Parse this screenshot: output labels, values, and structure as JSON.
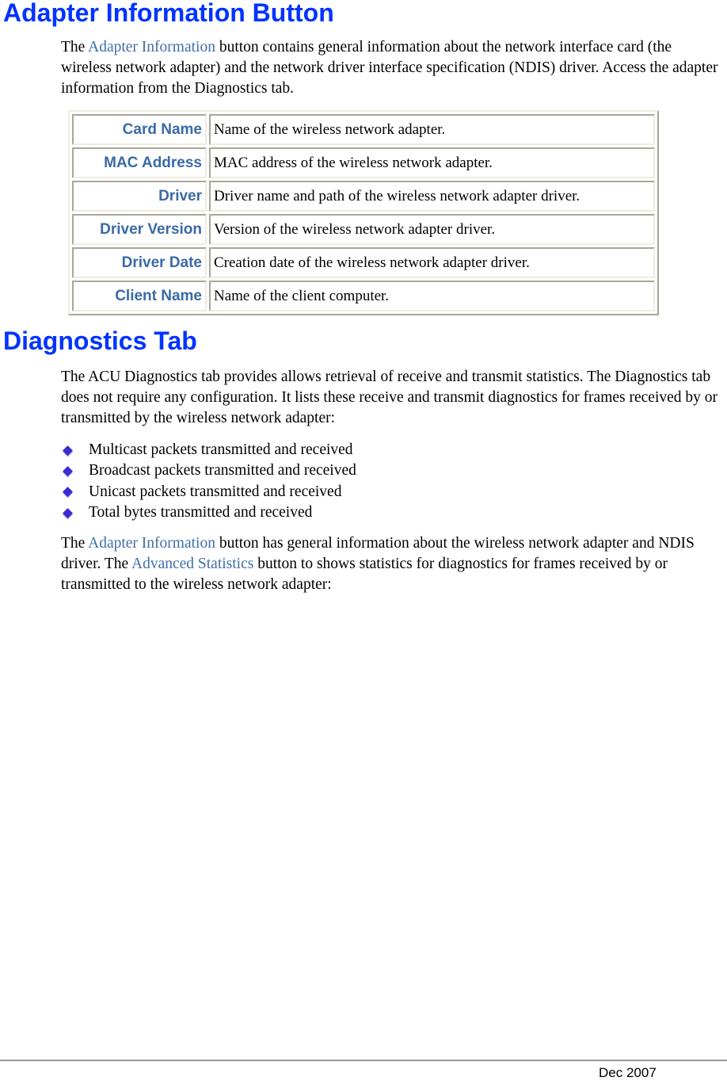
{
  "section1": {
    "heading": "Adapter Information Button",
    "paragraph": {
      "before": "The ",
      "link": "Adapter Information",
      "after": " button contains general information about the network interface card (the wireless network adapter) and the network driver interface specification (NDIS) driver.  Access the adapter information from the Diagnostics tab."
    },
    "table": [
      {
        "label": "Card Name",
        "description": "Name of the wireless network adapter."
      },
      {
        "label": "MAC Address",
        "description": "MAC address of the wireless network adapter."
      },
      {
        "label": "Driver",
        "description": "Driver name and path of the wireless network adapter driver."
      },
      {
        "label": "Driver Version",
        "description": "Version of the wireless network adapter driver."
      },
      {
        "label": "Driver Date",
        "description": "Creation date of the wireless network adapter driver."
      },
      {
        "label": "Client Name",
        "description": "Name of the client computer."
      }
    ]
  },
  "section2": {
    "heading": "Diagnostics Tab",
    "paragraph1": "The ACU Diagnostics tab provides allows retrieval of receive and transmit statistics. The Diagnostics tab does not require any configuration.  It lists these receive and transmit diagnostics for frames received by or transmitted by the wireless network adapter:",
    "bullets": [
      "Multicast packets transmitted and received",
      "Broadcast packets transmitted and received",
      "Unicast packets transmitted and received",
      "Total bytes transmitted and received"
    ],
    "paragraph2": {
      "t1": "The ",
      "link1": "Adapter Information",
      "t2": " button has general information about the wireless network adapter and NDIS driver.  The ",
      "link2": "Advanced Statistics",
      "t3": " button to shows statistics for diagnostics for frames received by or transmitted to the wireless network adapter:"
    }
  },
  "footer": {
    "date": "Dec 2007"
  },
  "colors": {
    "heading": "#0033ff",
    "link": "#3f6ea8",
    "table_label": "#3a6aa5",
    "bullet": "#3b2bd0"
  }
}
